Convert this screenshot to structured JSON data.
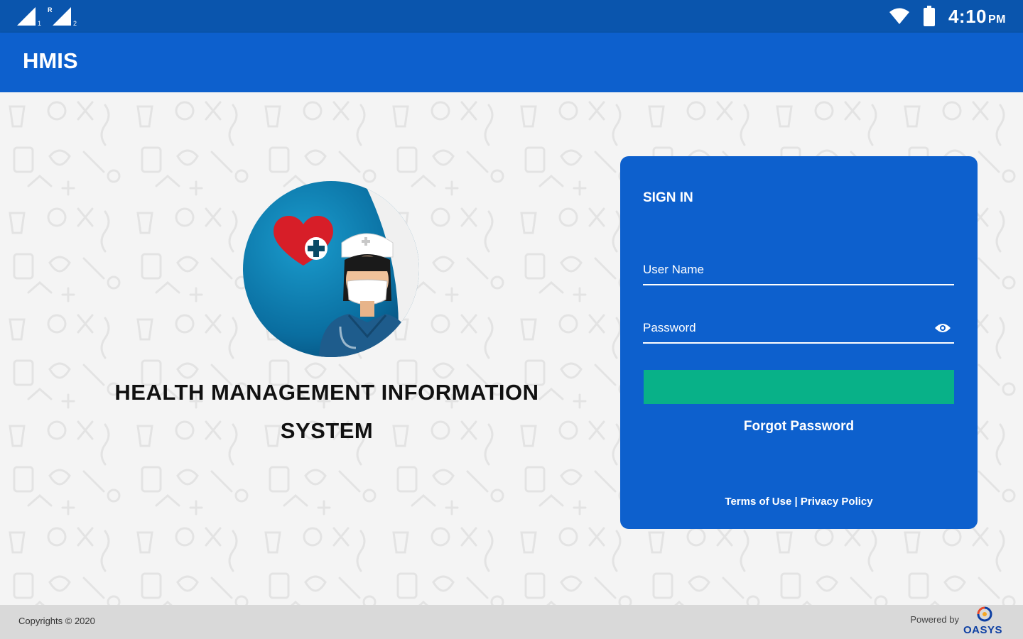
{
  "status_bar": {
    "time": "4:10",
    "ampm": "PM",
    "icons": [
      "signal-icon",
      "signal-roaming-icon",
      "wifi-icon",
      "battery-icon"
    ]
  },
  "app_bar": {
    "title": "HMIS"
  },
  "hero": {
    "heading_line1": "HEALTH MANAGEMENT INFORMATION",
    "heading_line2": "SYSTEM"
  },
  "login": {
    "title": "SIGN IN",
    "username_label": "User Name",
    "password_label": "Password",
    "forgot_password": "Forgot Password",
    "terms": "Terms of Use",
    "separator": "|",
    "privacy": "Privacy Policy"
  },
  "footer": {
    "copyright": "Copyrights © 2020",
    "powered_by": "Powered by",
    "brand": "OASYS"
  },
  "colors": {
    "status_bar": "#0a55ad",
    "primary": "#0d60cd",
    "button": "#08b188",
    "footer": "#d9d9d9"
  }
}
